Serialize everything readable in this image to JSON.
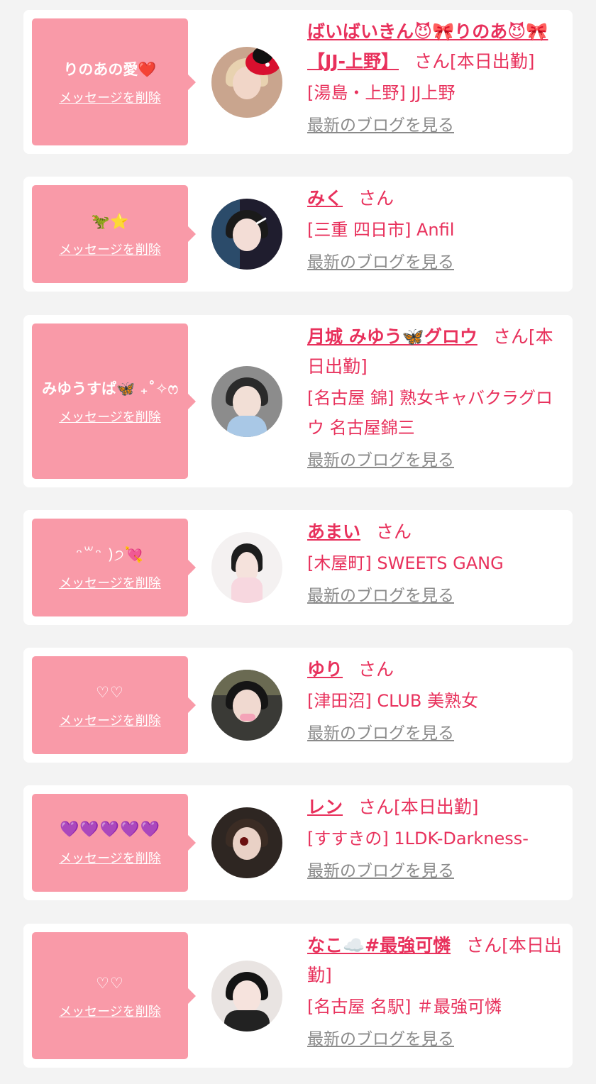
{
  "delete_label": "メッセージを削除",
  "blog_label": "最新のブログを見る",
  "colors": {
    "background": "#f3f3f3",
    "bubble": "#f99aa8",
    "accent": "#e8315c",
    "muted": "#8a8a8a"
  },
  "favorites": [
    {
      "memo": "りのあの愛❤️",
      "name": "ばいばいきん😈🎀りのあ😈🎀【JJ-上野】",
      "suffix": "さん[本日出勤]",
      "shop": "[湯島・上野] JJ上野"
    },
    {
      "memo": "🦖⭐",
      "name": "みく",
      "suffix": "さん",
      "shop": "[三重 四日市] Anfil"
    },
    {
      "memo": "みゆうすぱ🦋 ₊˚✧ෆ",
      "name": "月城 みゆう🦋グロウ",
      "suffix": "さん[本日出勤]",
      "shop": "[名古屋 錦] 熟女キャバクラグロウ 名古屋錦三"
    },
    {
      "memo": "ᵔ꒳ᵔ )੭💘",
      "name": "あまい",
      "suffix": "さん",
      "shop": "[木屋町] SWEETS GANG"
    },
    {
      "memo": "♡♡",
      "name": "ゆり",
      "suffix": "さん",
      "shop": "[津田沼] CLUB 美熟女"
    },
    {
      "memo": "💜💜💜💜💜",
      "name": "レン",
      "suffix": "さん[本日出勤]",
      "shop": "[すすきの] 1LDK-Darkness-"
    },
    {
      "memo": "♡♡",
      "name": "なこ☁️#最強可憐",
      "suffix": "さん[本日出勤]",
      "shop": "[名古屋 名駅] ＃最強可憐"
    }
  ]
}
